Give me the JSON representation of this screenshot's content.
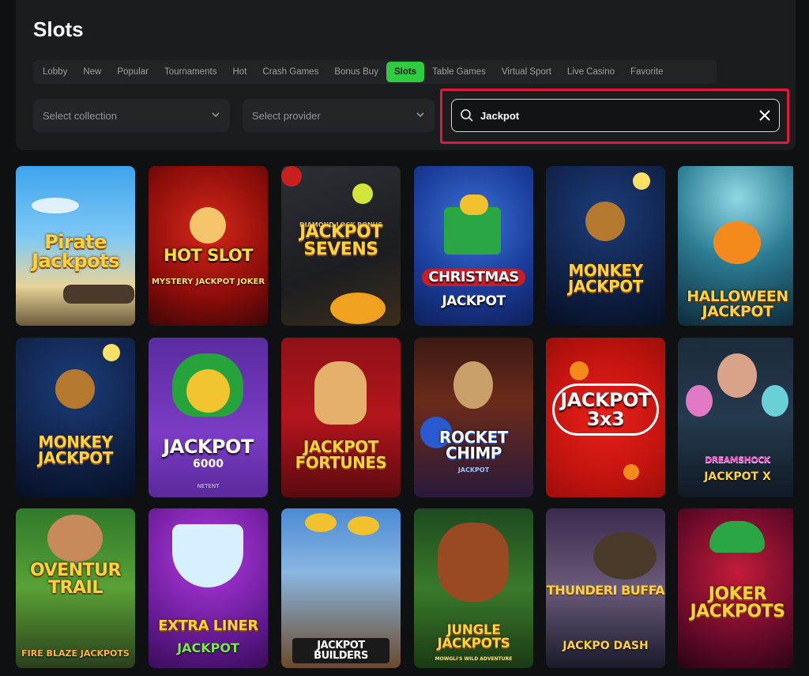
{
  "page": {
    "title": "Slots"
  },
  "tabs": [
    {
      "label": "Lobby"
    },
    {
      "label": "New"
    },
    {
      "label": "Popular"
    },
    {
      "label": "Tournaments"
    },
    {
      "label": "Hot"
    },
    {
      "label": "Crash Games"
    },
    {
      "label": "Bonus Buy"
    },
    {
      "label": "Slots",
      "active": true
    },
    {
      "label": "Table Games"
    },
    {
      "label": "Virtual Sport"
    },
    {
      "label": "Live Casino"
    },
    {
      "label": "Favorite"
    }
  ],
  "filters": {
    "collection_placeholder": "Select collection",
    "provider_placeholder": "Select provider"
  },
  "search": {
    "value": "Jackpot",
    "icon": "search-icon",
    "clear_icon": "close-icon"
  },
  "colors": {
    "accent": "#2ecc40",
    "highlight": "#e3173e",
    "background": "#0f1011",
    "panel": "#1b1c1e"
  },
  "games": [
    {
      "title": "Pirate Jackpots"
    },
    {
      "title": "HOT SLOT",
      "subtitle": "MYSTERY JACKPOT JOKER"
    },
    {
      "title": "JACKPOT SEVENS",
      "subtitle": "DIAMOND LOCK BONUS"
    },
    {
      "title": "CHRISTMAS",
      "subtitle": "JACKPOT"
    },
    {
      "title": "MONKEY JACKPOT"
    },
    {
      "title": "HALLOWEEN JACKPOT"
    },
    {
      "title": "MONKEY JACKPOT"
    },
    {
      "title": "JACKPOT",
      "subtitle": "6000",
      "provider": "NETENT"
    },
    {
      "title": "JACKPOT FORTUNES"
    },
    {
      "title": "ROCKET CHIMP",
      "subtitle": "JACKPOT"
    },
    {
      "title": "JACKPOT 3x3"
    },
    {
      "title": "DREAMSHOCK",
      "subtitle": "JACKPOT X"
    },
    {
      "title": "OVENTUR TRAIL",
      "subtitle": "FIRE BLAZE JACKPOTS"
    },
    {
      "title": "EXTRA LINER",
      "subtitle": "JACKPOT"
    },
    {
      "title": "JACKPOT BUILDERS"
    },
    {
      "title": "JUNGLE JACKPOTS",
      "subtitle": "MOWGLI'S WILD ADVENTURE"
    },
    {
      "title": "THUNDERI BUFFA",
      "subtitle": "JACKPO DASH"
    },
    {
      "title": "JOKER JACKPOTS"
    }
  ]
}
